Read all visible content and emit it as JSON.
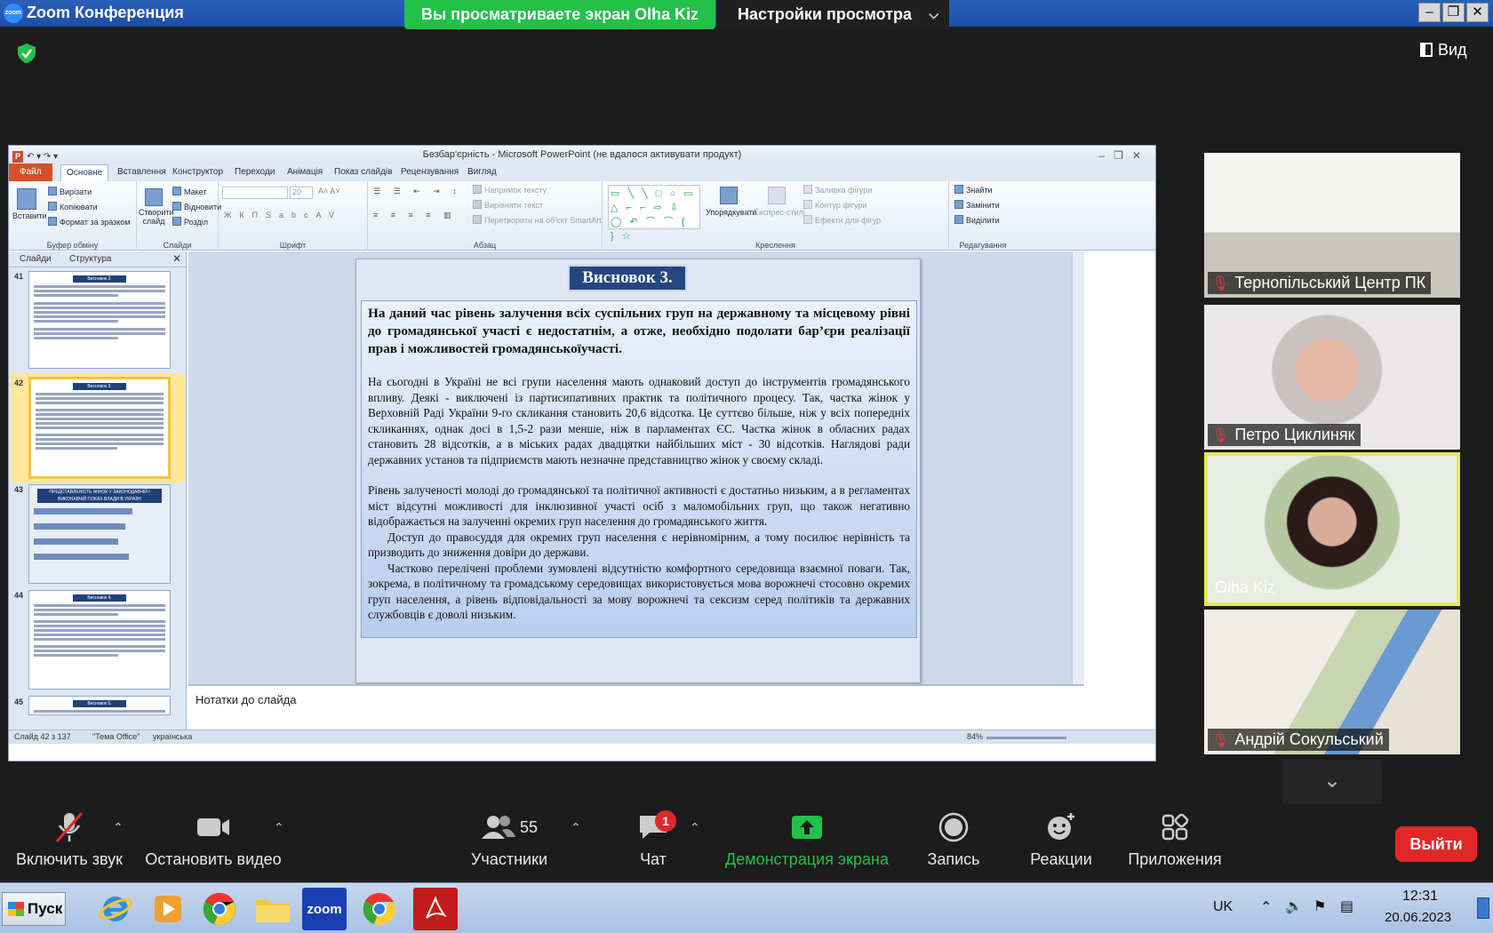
{
  "window": {
    "app_title": "Zoom Конференция",
    "logo_text": "zoom",
    "viewing_banner": "Вы просматриваете экран Olha Kiz",
    "view_settings": "Настройки просмотра",
    "view_button": "Вид"
  },
  "ppt": {
    "title": "Безбар'єрність - Microsoft PowerPoint (не вдалося активувати продукт)",
    "tabs": [
      "Файл",
      "Основне",
      "Вставлення",
      "Конструктор",
      "Переходи",
      "Анімація",
      "Показ слайдів",
      "Рецензування",
      "Вигляд"
    ],
    "ribbon": {
      "paste": "Вставити",
      "cut": "Вирізати",
      "copy": "Копіювати",
      "format_painter": "Формат за зразком",
      "clipboard_group": "Буфер обміну",
      "new_slide": "Створити слайд",
      "layout": "Макет",
      "reset": "Відновити",
      "section": "Розділ",
      "slides_group": "Слайди",
      "font_size": "20",
      "font_group": "Шрифт",
      "text_direction": "Напрямок тексту",
      "align_text": "Вирівняти текст",
      "smartart": "Перетворити на об'єкт SmartArt",
      "paragraph_group": "Абзац",
      "arrange": "Упорядкувати",
      "quick_styles": "Експрес-стилі",
      "shape_fill": "Заливка фігури",
      "shape_outline": "Контур фігури",
      "shape_effects": "Ефекти для фігур",
      "drawing_group": "Креслення",
      "find": "Знайти",
      "replace": "Замінити",
      "select": "Виділити",
      "editing_group": "Редагування"
    },
    "panel_tabs": [
      "Слайди",
      "Структура"
    ],
    "thumbs": [
      {
        "num": "41",
        "title": "Висновок 2."
      },
      {
        "num": "42",
        "title": "Висновок 3."
      },
      {
        "num": "43",
        "title": "ПРЕДСТАВЛЕНІСТЬ ЖІНОК У ЗАКОНОДАВЧІЙ І ВИКОНАВЧІЙ ГІЛКАХ ВЛАДИ В УКРАЇНІ"
      },
      {
        "num": "44",
        "title": "Висновок 4."
      },
      {
        "num": "45",
        "title": "Висновок 5."
      }
    ],
    "slide": {
      "title": "Висновок 3.",
      "lead": "На даний час рівень залучення всіх суспільних груп на державному та місцевому рівні до громадянської участі є недостатнім, а отже, необхідно подолати бар’єри реалізації прав і можливостей громадянськоїучасті.",
      "p1": "На сьогодні в Україні не всі групи населення мають однаковий доступ до інструментів громадянського впливу. Деякі - виключені із партисипативних практик та політичного процесу. Так, частка жінок у Верховній Раді України 9-го скликання становить 20,6 відсотка. Це суттєво більше, ніж у всіх попередніх скликаннях, однак досі в 1,5-2 рази менше, ніж в парламентах ЄС. Частка жінок в обласних радах становить 28 відсоткі­в, а в міських радах двадцятки найбільших міст - 30 відсоткі­в. Наглядові ради державних установ та підприємств мають незначне представництво жінок у своєму складі.",
      "p2": " Рівень залученості молоді до громадянської та політичної активності є достатньо низьким, а в регламентах міст відсутні можливості для інклюзивної участі осіб з маломобільних груп, що також негативно відображається на залученні окремих груп населення до громадянського життя.",
      "p3": "Доступ до правосуддя для окремих груп населення є нерівномірним, а тому посилює нерівність та призводить до зниження довіри до держави.",
      "p4": "Частково перелічені проблеми зумовлені відсутністю комфортного середовища взаємної поваги. Так, зокрема, в політичному та громадському середовищах використовується мова ворожнечі стосовно окремих груп населення, а рівень відповідальності за мову ворожнечі та сексизм серед політиків та державних службовців є доволі низьким."
    },
    "notes_placeholder": "Нотатки до слайда",
    "status": {
      "slide": "Слайд 42 з 137",
      "theme": "\"Тема Office\"",
      "lang": "українська",
      "zoom": "84%"
    }
  },
  "participants": [
    {
      "name": "Тернопільський Центр ПК",
      "muted": true
    },
    {
      "name": "Петро Циклиняк",
      "muted": true
    },
    {
      "name": "Olha Kiz",
      "muted": false,
      "active": true
    },
    {
      "name": "Андрій Сокульський",
      "muted": true
    }
  ],
  "toolbar": {
    "unmute": "Включить звук",
    "stop_video": "Остановить видео",
    "participants": "Участники",
    "participants_count": "55",
    "chat": "Чат",
    "chat_badge": "1",
    "share": "Демонстрация экрана",
    "record": "Запись",
    "reactions": "Реакции",
    "apps": "Приложения",
    "leave": "Выйти"
  },
  "taskbar": {
    "start": "Пуск",
    "lang": "UK",
    "time": "12:31",
    "date": "20.06.2023"
  },
  "colors": {
    "zoom_green": "#23c04a",
    "leave_red": "#e02828",
    "active_speaker": "#e6e95a",
    "slide_title_bg": "#24467f"
  }
}
